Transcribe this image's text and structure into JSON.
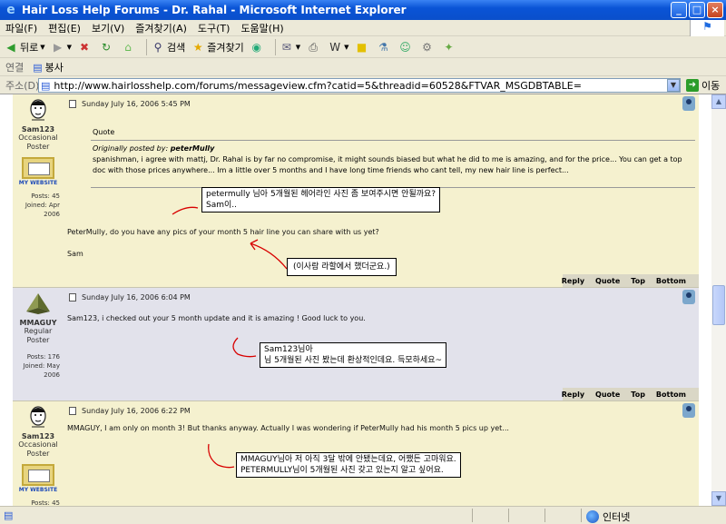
{
  "window": {
    "title": "Hair Loss Help Forums - Dr. Rahal - Microsoft Internet Explorer"
  },
  "menu": [
    "파일(F)",
    "편집(E)",
    "보기(V)",
    "즐겨찾기(A)",
    "도구(T)",
    "도움말(H)"
  ],
  "toolbar": {
    "back": "뒤로",
    "search": "검색",
    "favorites": "즐겨찾기"
  },
  "links": {
    "label": "연결",
    "item": "봉사"
  },
  "address": {
    "label": "주소(D)",
    "url": "http://www.hairlosshelp.com/forums/messageview.cfm?catid=5&threadid=60528&FTVAR_MSGDBTABLE=",
    "go": "이동"
  },
  "status": {
    "zone": "인터넷"
  },
  "actions": {
    "reply": "Reply",
    "quote": "Quote",
    "top": "Top",
    "bottom": "Bottom"
  },
  "posts": [
    {
      "author": "Sam123",
      "rank": [
        "Occasional",
        "Poster"
      ],
      "website": "MY WEBSITE",
      "posts_label": "Posts: 45",
      "joined": [
        "Joined: Apr",
        "2006"
      ],
      "date": "Sunday July 16, 2006 5:45 PM",
      "quote_label": "Quote",
      "quote_by_prefix": "Originally posted by: ",
      "quote_by_name": "peterMully",
      "quote_text": "spanishman, i agree with mattj, Dr. Rahal is by far no compromise, it might sounds biased but what he did to me is amazing, and for the price... You can get a top doc with those prices anywhere... Im a little over 5 months and I have long time friends who cant tell, my new hair line is perfect...",
      "text": "PeterMully, do you have any pics of your month 5 hair line you can share with us yet?",
      "sign": "Sam",
      "note1": [
        "petermully 님아 5개월된 헤어라인 사진 좀 보여주시면 안될까요?",
        "Sam이.."
      ],
      "note2": "(이사람 라할에서 했더군요.)"
    },
    {
      "author": "MMAGUY",
      "rank": [
        "Regular",
        "Poster"
      ],
      "posts_label": "Posts: 176",
      "joined": [
        "Joined: May",
        "2006"
      ],
      "date": "Sunday July 16, 2006 6:04 PM",
      "text": "Sam123, i checked out your 5 month update and it is amazing ! Good luck to you.",
      "note": [
        "Sam123님아",
        "님 5개월된 사진 봤는데 환상적인데요. 득모하세요~"
      ]
    },
    {
      "author": "Sam123",
      "rank": [
        "Occasional",
        "Poster"
      ],
      "website": "MY WEBSITE",
      "posts_label": "Posts: 45",
      "date": "Sunday July 16, 2006 6:22 PM",
      "text": "MMAGUY, I am only on month 3! But thanks anyway. Actually I was wondering if PeterMully had his month 5 pics up yet...",
      "note": [
        "MMAGUY님아 저 아직 3달 밖에 안됐는데요, 어쨌든 고마워요.",
        "PETERMULLY님이 5개월된 사진 갖고 있는지 알고 싶어요."
      ]
    }
  ],
  "colors": {
    "post1_bg": "#f5f1cf",
    "post2_bg": "#e2e2eb",
    "post3_bg": "#f5f1cf",
    "annotation": "#d80000",
    "xp_blue": "#0a54d6"
  }
}
